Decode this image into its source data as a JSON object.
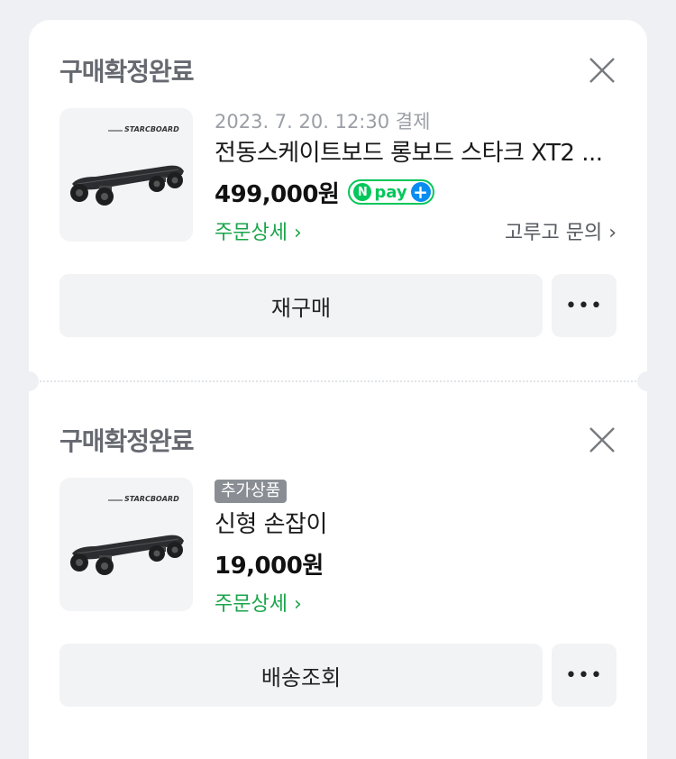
{
  "orders": [
    {
      "status": "구매확정완료",
      "date": "2023. 7. 20. 12:30 결제",
      "badge": "",
      "title": "전동스케이트보드 롱보드 스타크 XT2 ...",
      "price": "499,000원",
      "npay": {
        "n": "N",
        "pay": "pay",
        "plus": "+"
      },
      "detail_link": "주문상세",
      "inquiry_link": "고루고 문의",
      "primary_button": "재구매",
      "more_button": "•••",
      "brand_logo": "STARCBOARD"
    },
    {
      "status": "구매확정완료",
      "date": "",
      "badge": "추가상품",
      "title": "신형 손잡이",
      "price": "19,000원",
      "detail_link": "주문상세",
      "primary_button": "배송조회",
      "more_button": "•••",
      "brand_logo": "STARCBOARD"
    }
  ],
  "colors": {
    "accent_green": "#1aa54a",
    "npay_green": "#03c75a",
    "npay_blue": "#0a8cf0",
    "background": "#eef0f4"
  },
  "icons": {
    "close": "close-icon",
    "chevron": "chevron-right-icon",
    "product": "skateboard-image"
  }
}
